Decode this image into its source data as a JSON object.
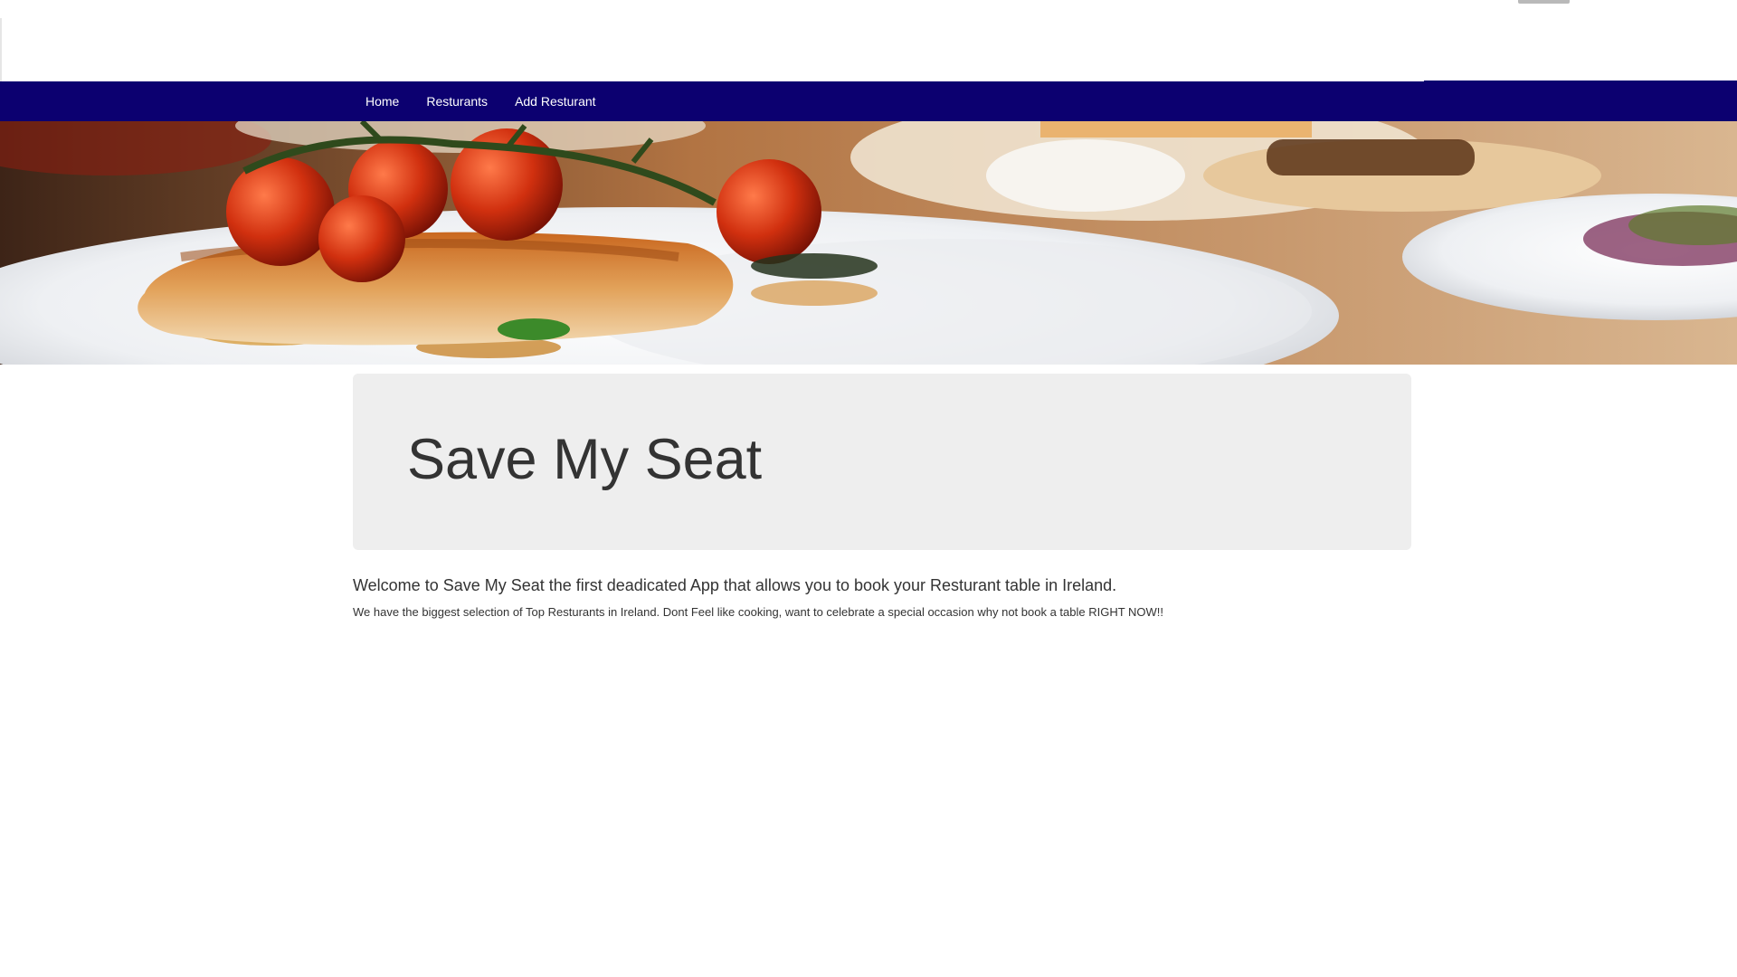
{
  "navbar": {
    "links": [
      {
        "label": "Home"
      },
      {
        "label": "Resturants"
      },
      {
        "label": "Add Resturant"
      }
    ],
    "background_color": "#0c0070"
  },
  "hero": {
    "image": "food-banner-image"
  },
  "jumbotron": {
    "title": "Save My Seat"
  },
  "content": {
    "lead": "Welcome to Save My Seat the first deadicated App that allows you to book your Resturant table in Ireland.",
    "sub": "We have the biggest selection of Top Resturants in Ireland. Dont Feel like cooking, want to celebrate a special occasion why not book a table RIGHT NOW!!"
  }
}
